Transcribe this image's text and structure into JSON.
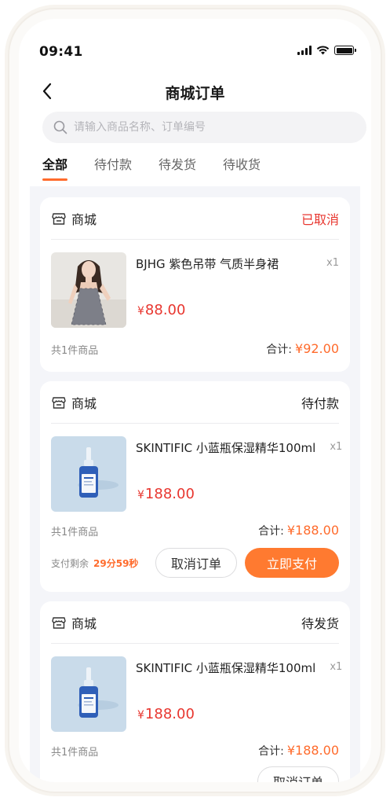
{
  "status_bar": {
    "time": "09:41"
  },
  "nav": {
    "title": "商城订单"
  },
  "search": {
    "placeholder": "请输入商品名称、订单编号"
  },
  "tabs": [
    {
      "label": "全部",
      "active": true
    },
    {
      "label": "待付款",
      "active": false
    },
    {
      "label": "待发货",
      "active": false
    },
    {
      "label": "待收货",
      "active": false
    }
  ],
  "orders": [
    {
      "shop": "商城",
      "status": "已取消",
      "item_name": "BJHG 紫色吊带 气质半身裙",
      "qty": "x1",
      "price": "88.00",
      "currency": "¥",
      "count": "共1件商品",
      "total_label": "合计:",
      "total": "¥92.00"
    },
    {
      "shop": "商城",
      "status": "待付款",
      "item_name": "SKINTIFIC 小蓝瓶保湿精华100ml",
      "qty": "x1",
      "price": "188.00",
      "currency": "¥",
      "count": "共1件商品",
      "total_label": "合计:",
      "total": "¥188.00",
      "countdown_label": "支付剩余",
      "countdown_value": "29分59秒",
      "cancel_label": "取消订单",
      "pay_label": "立即支付"
    },
    {
      "shop": "商城",
      "status": "待发货",
      "item_name": "SKINTIFIC 小蓝瓶保湿精华100ml",
      "qty": "x1",
      "price": "188.00",
      "currency": "¥",
      "count": "共1件商品",
      "total_label": "合计:",
      "total": "¥188.00",
      "cancel_label": "取消订单"
    }
  ],
  "colors": {
    "accent": "#ff7a30",
    "price": "#e8362f",
    "background": "#f4f5f9"
  },
  "icons": [
    "chevron-left-icon",
    "search-icon",
    "shop-icon",
    "signal-icon",
    "wifi-icon",
    "battery-icon"
  ]
}
